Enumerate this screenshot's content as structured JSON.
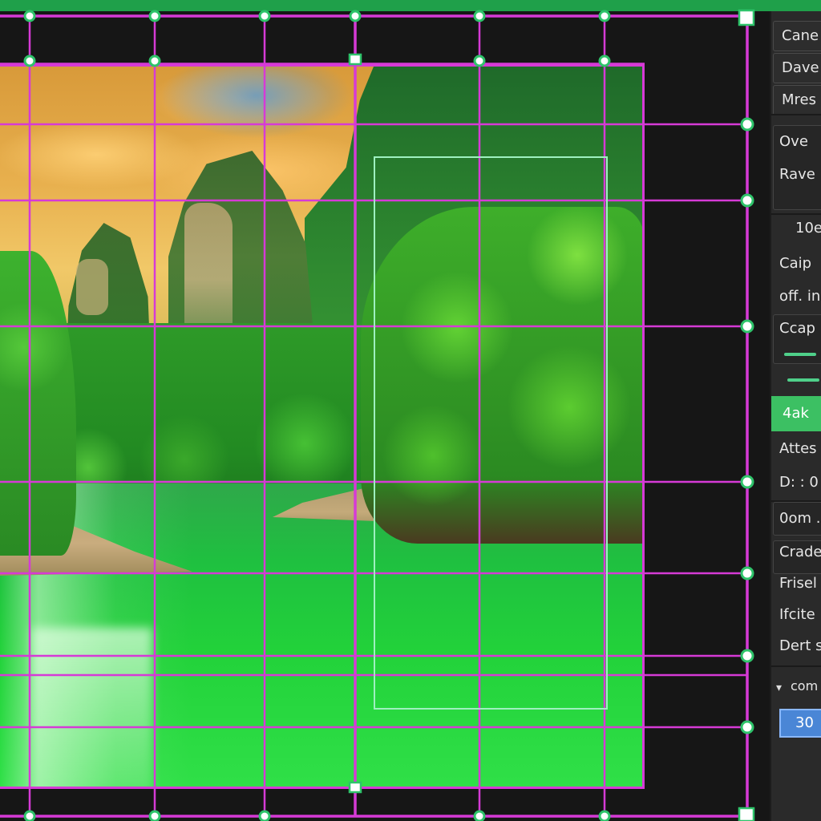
{
  "colors": {
    "accent_top": "#1fa04a",
    "grid_line": "#d63ad6",
    "handle_fill": "#ffffff",
    "handle_edge": "#2ec36a",
    "active_item": "#3cc063",
    "input_bg": "#4a86d6"
  },
  "panel": {
    "buttons": [
      "Cane",
      "Dave",
      "Mres"
    ],
    "labels_a": [
      "Ove",
      "Rave"
    ],
    "value_1": "10e",
    "labels_b": [
      "Caip",
      "off. in",
      "Ccap"
    ],
    "active_label": "4ak",
    "labels_c": [
      "Attes",
      "D: : 0"
    ],
    "labels_d": [
      "0om .",
      "Crade",
      "Frisel",
      "Ifcite",
      "Dert s"
    ],
    "section_label": "com",
    "number_value": "30"
  }
}
